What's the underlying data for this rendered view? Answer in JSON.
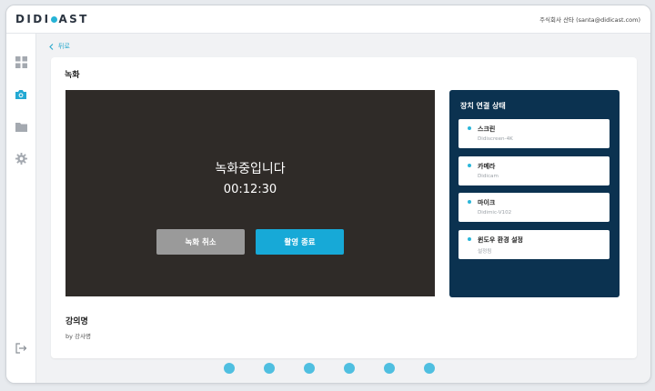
{
  "app": {
    "logo_left": "DIDI",
    "logo_right": "AST",
    "account": "주식회사 산타 (santa@didicast.com)",
    "accent": "#27b3d6"
  },
  "sidebar": {
    "items": [
      {
        "icon": "dashboard-icon"
      },
      {
        "icon": "camera-icon",
        "active": true
      },
      {
        "icon": "folder-icon"
      },
      {
        "icon": "gear-icon"
      }
    ],
    "logout_icon": "logout-icon"
  },
  "main": {
    "back_label": "뒤로",
    "page_title": "녹화",
    "recording": {
      "status": "녹화중입니다",
      "elapsed": "00:12:30",
      "cancel_label": "녹화 취소",
      "end_label": "촬영 종료"
    },
    "devices": {
      "title": "장치 연결 상태",
      "items": [
        {
          "name": "스크린",
          "detail": "Didiscreen-4K"
        },
        {
          "name": "카메라",
          "detail": "Didicam"
        },
        {
          "name": "마이크",
          "detail": "Didimic-V102"
        },
        {
          "name": "윈도우 환경 설정",
          "detail": "설정됨"
        }
      ]
    },
    "course": {
      "title": "강의명",
      "lecturer": "by 강사명"
    }
  },
  "pager": {
    "count": 6
  }
}
